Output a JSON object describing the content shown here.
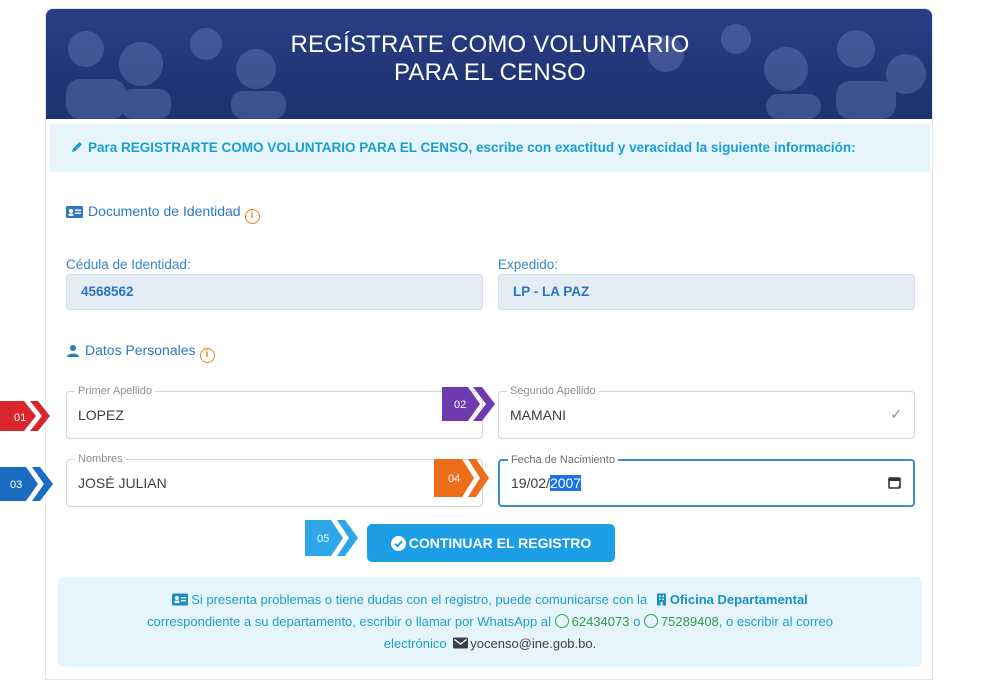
{
  "header": {
    "title_line1": "REGÍSTRATE COMO VOLUNTARIO",
    "title_line2": "PARA EL CENSO"
  },
  "banner": {
    "text": "Para REGISTRARTE COMO VOLUNTARIO PARA EL CENSO, escribe con exactitud y veracidad la siguiente información:"
  },
  "identity": {
    "section_label": "Documento de Identidad",
    "ci_label": "Cédula de Identidad:",
    "ci_value": "4568562",
    "expedido_label": "Expedido:",
    "expedido_value": "LP - LA PAZ"
  },
  "personal": {
    "section_label": "Datos Personales",
    "primer_apellido_label": "Primer Apellido",
    "primer_apellido_value": "LOPEZ",
    "segundo_apellido_label": "Segundo Apellido",
    "segundo_apellido_value": "MAMANI",
    "nombres_label": "Nombres",
    "nombres_value": "JOSÉ JULIAN",
    "fecha_label": "Fecha de Nacimiento",
    "fecha_prefix": "19/02/",
    "fecha_selected": "2007"
  },
  "steps": {
    "s1": "01",
    "s2": "02",
    "s3": "03",
    "s4": "04",
    "s5": "05"
  },
  "continue_button": {
    "label": "CONTINUAR EL REGISTRO"
  },
  "help": {
    "text1": "Si presenta problemas o tiene dudas con el registro, puede comunicarse con la",
    "office": "Oficina Departamental",
    "text2": "correspondiente a su departamento, escribir o llamar por WhatsApp al",
    "phone1": "62434073",
    "or": "o",
    "phone2": "75289408",
    "text3": ", o escribir al correo",
    "text4": "electrónico",
    "email": "yocenso@ine.gob.bo",
    "period": "."
  },
  "colors": {
    "header": "#223576",
    "accent": "#1c9ee6",
    "step1": "#d8262c",
    "step2": "#6f3ab0",
    "step3": "#1b6bc0",
    "step4": "#ec6e1a",
    "step5": "#2ea6e8"
  }
}
